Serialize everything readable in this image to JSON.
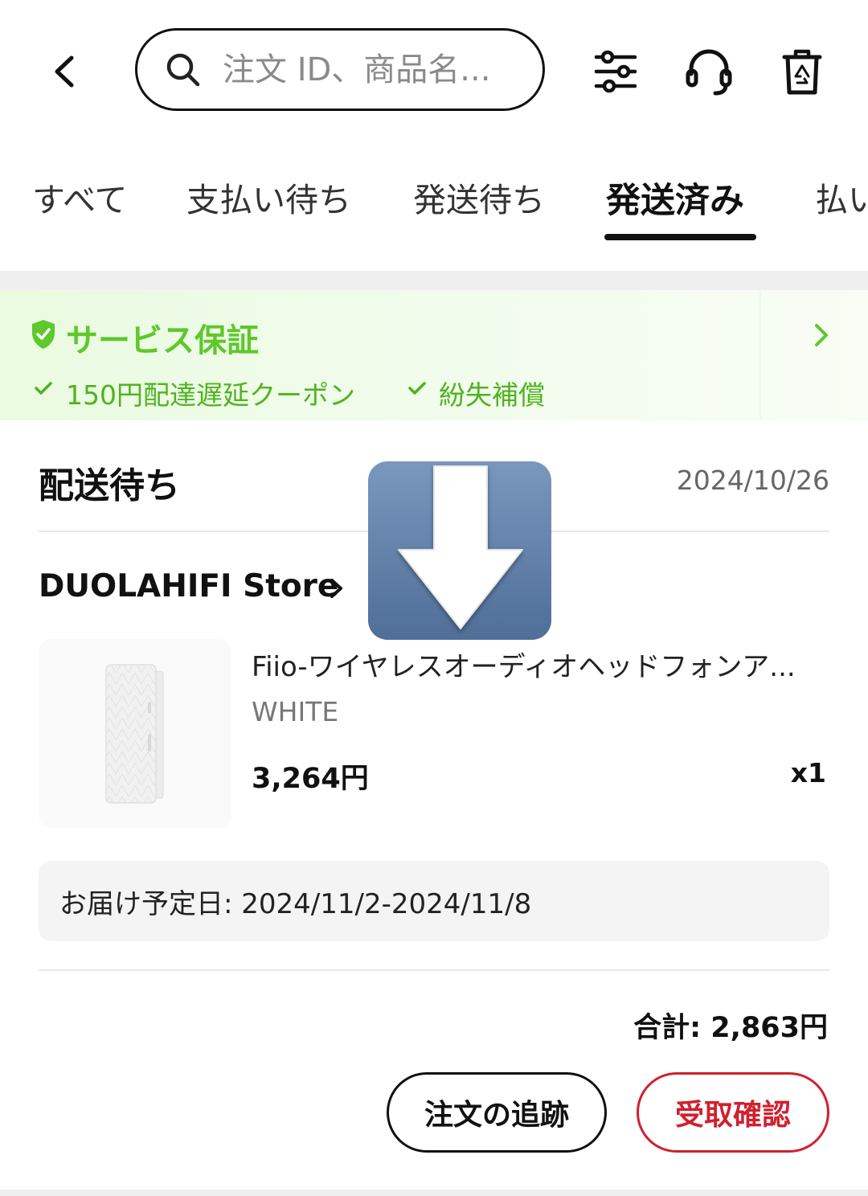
{
  "header": {
    "search_placeholder": "注文 ID、商品名..."
  },
  "tabs": [
    {
      "label": "すべて"
    },
    {
      "label": "支払い待ち"
    },
    {
      "label": "発送待ち"
    },
    {
      "label": "発送済み",
      "active": true
    },
    {
      "label": "払い"
    }
  ],
  "service": {
    "title": "サービス保証",
    "items": [
      "150円配達遅延クーポン",
      "紛失補償"
    ],
    "accent_color": "#5ec82c"
  },
  "order": {
    "status": "配送待ち",
    "date": "2024/10/26",
    "store": "DUOLAHIFI Store",
    "product": {
      "title": "Fiio-ワイヤレスオーディオヘッドフォンア...",
      "variant": "WHITE",
      "price": "3,264円",
      "qty": "x1"
    },
    "delivery": "お届け予定日: 2024/11/2-2024/11/8",
    "total": "合計: 2,863円",
    "track_label": "注文の追跡",
    "confirm_label": "受取確認",
    "confirm_color": "#d0202e"
  },
  "icons": [
    "back-arrow-icon",
    "search-icon",
    "filter-sliders-icon",
    "headset-icon",
    "recycle-bin-icon",
    "shield-check-icon",
    "chevron-right-icon",
    "check-icon",
    "download-arrow-icon"
  ]
}
